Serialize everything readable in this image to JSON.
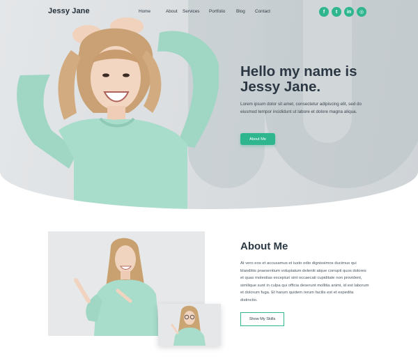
{
  "brand": {
    "name": "Jessy Jane"
  },
  "nav": {
    "items": [
      {
        "label": "Home"
      },
      {
        "label": "About"
      },
      {
        "label": "Services"
      },
      {
        "label": "Portfolio"
      },
      {
        "label": "Blog"
      },
      {
        "label": "Contact"
      }
    ]
  },
  "social": [
    {
      "icon": "facebook-icon",
      "glyph": "f"
    },
    {
      "icon": "twitter-icon",
      "glyph": "t"
    },
    {
      "icon": "linkedin-icon",
      "glyph": "in"
    },
    {
      "icon": "instagram-icon",
      "glyph": "◎"
    }
  ],
  "hero": {
    "title_line1": "Hello my name is",
    "title_line2": "Jessy Jane.",
    "description": "Lorem ipsum dolor sit amet, consectetur adipiscing elit, sed do eiusmod tempor incididunt ut labore et dolore magna aliqua.",
    "button_label": "About Me"
  },
  "about": {
    "title": "About Me",
    "description": "At vero eos et accusamus et iusto odio dignissimos ducimus qui blanditiis praesentium voluptatum deleniti atque corrupti quos dolores et quas molestias excepturi sint occaecati cupiditate non provident, similique sunt in culpa qui officia deserunt mollitia animi, id est laborum et dolorum fuga. Et harum quidem rerum facilis est et expedita distinctio.",
    "button_label": "Show My Skills"
  },
  "colors": {
    "accent": "#2fb68f",
    "heading": "#2b3844",
    "sweater": "#a8dccb"
  }
}
